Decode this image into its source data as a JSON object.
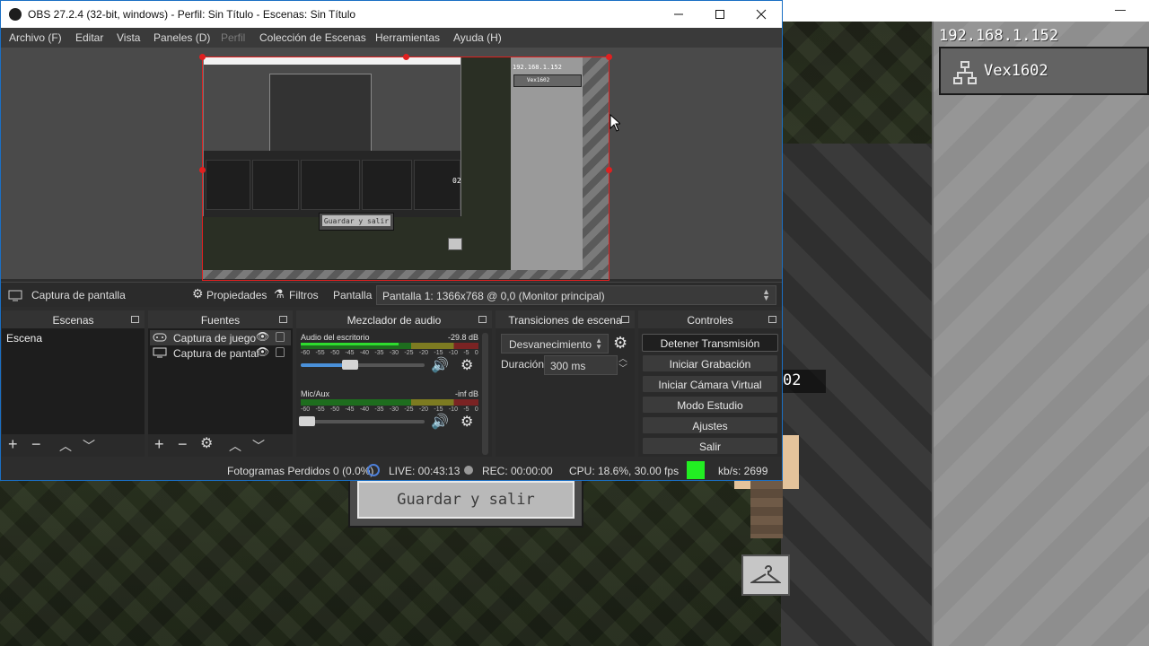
{
  "window": {
    "title": "OBS 27.2.4 (32-bit, windows) - Perfil: Sin Título - Escenas: Sin Título"
  },
  "menu": [
    {
      "label": "Archivo (F)",
      "enabled": true
    },
    {
      "label": "Editar",
      "enabled": true
    },
    {
      "label": "Vista",
      "enabled": true
    },
    {
      "label": "Paneles (D)",
      "enabled": true
    },
    {
      "label": "Perfil",
      "enabled": false
    },
    {
      "label": "Colección de Escenas",
      "enabled": true
    },
    {
      "label": "Herramientas",
      "enabled": true
    },
    {
      "label": "Ayuda (H)",
      "enabled": true
    }
  ],
  "source_toolbar": {
    "source_name": "Captura de pantalla",
    "properties": "Propiedades",
    "filters": "Filtros",
    "display_label": "Pantalla",
    "display_value": "Pantalla 1: 1366x768 @ 0,0 (Monitor principal)"
  },
  "docks": {
    "scenes": {
      "title": "Escenas",
      "items": [
        "Escena"
      ]
    },
    "sources": {
      "title": "Fuentes",
      "items": [
        {
          "label": "Captura de juego",
          "icon": "gamepad-icon"
        },
        {
          "label": "Captura de pantal",
          "icon": "monitor-icon"
        }
      ]
    },
    "mixer": {
      "title": "Mezclador de audio",
      "channels": [
        {
          "name": "Audio del escritorio",
          "db": "-29.8 dB",
          "level": 0.55,
          "volume": 0.4
        },
        {
          "name": "Mic/Aux",
          "db": "-inf dB",
          "level": 0.0,
          "volume": 0.05
        }
      ],
      "ticks": [
        "-60",
        "-55",
        "-50",
        "-45",
        "-40",
        "-35",
        "-30",
        "-25",
        "-20",
        "-15",
        "-10",
        "-5",
        "0"
      ]
    },
    "transitions": {
      "title": "Transiciones de escena",
      "selected": "Desvanecimiento",
      "duration_label": "Duración",
      "duration": "300 ms"
    },
    "controls": {
      "title": "Controles",
      "buttons": [
        "Detener Transmisión",
        "Iniciar Grabación",
        "Iniciar Cámara Virtual",
        "Modo Estudio",
        "Ajustes",
        "Salir"
      ]
    }
  },
  "status": {
    "dropped": "Fotogramas Perdidos 0 (0.0%)",
    "live": "LIVE: 00:43:13",
    "rec": "REC: 00:00:00",
    "cpu": "CPU: 18.6%, 30.00 fps",
    "kbps": "kb/s: 2699",
    "health_color": "#22ee22"
  },
  "game": {
    "server_ip": "192.168.1.152",
    "server_name": "Vex1602",
    "save_button": "Guardar y salir",
    "nametag_fragment": "02"
  },
  "preview_capture": {
    "ip": "192.168.1.152",
    "name": "Vex1602",
    "save_button": "Guardar y salir",
    "tag": "02"
  },
  "colors": {
    "accent": "#4a90d9",
    "selection": "#e02020",
    "live_icon": "#4d7fd8"
  }
}
